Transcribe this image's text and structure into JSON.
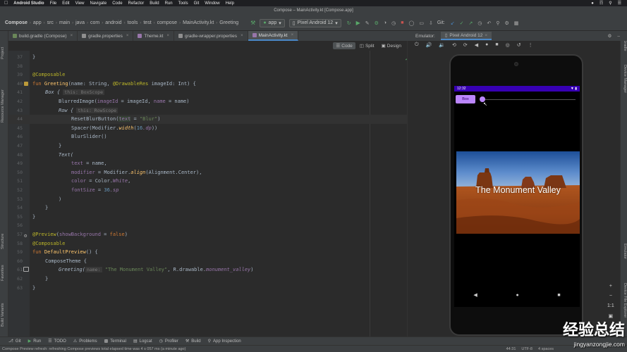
{
  "mac_menu": {
    "app": "Android Studio",
    "items": [
      "File",
      "Edit",
      "View",
      "Navigate",
      "Code",
      "Refactor",
      "Build",
      "Run",
      "Tools",
      "Git",
      "Window",
      "Help"
    ]
  },
  "window_title": "Compose – MainActivity.kt [Compose.app]",
  "breadcrumb": [
    "Compose",
    "app",
    "src",
    "main",
    "java",
    "com",
    "android",
    "tools",
    "test",
    "compose",
    "MainActivity.kt",
    "Greeting"
  ],
  "run_config": "app",
  "device_combo": "Pixel Android 12",
  "git_label": "Git:",
  "tabs": [
    {
      "label": "build.gradle (Compose)",
      "color": "#6a8759",
      "active": false
    },
    {
      "label": "gradle.properties",
      "color": "#a9b7c6",
      "active": false
    },
    {
      "label": "Theme.kt",
      "color": "#9876aa",
      "active": false
    },
    {
      "label": "gradle-wrapper.properties",
      "color": "#a9b7c6",
      "active": false
    },
    {
      "label": "MainActivity.kt",
      "color": "#9876aa",
      "active": true
    }
  ],
  "emulator": {
    "label": "Emulator:",
    "device_tab": "Pixel Android 12",
    "status_time": "12:32",
    "box_button": "Box",
    "image_caption": "The Monument Valley",
    "slider_value": 0
  },
  "editor_modes": {
    "code": "Code",
    "split": "Split",
    "design": "Design"
  },
  "code_lines": [
    {
      "n": "37"
    },
    {
      "n": "38"
    },
    {
      "n": "39"
    },
    {
      "n": "40"
    },
    {
      "n": "41"
    },
    {
      "n": "42"
    },
    {
      "n": "43"
    },
    {
      "n": "44"
    },
    {
      "n": "45"
    },
    {
      "n": "46"
    },
    {
      "n": "47"
    },
    {
      "n": "48"
    },
    {
      "n": "49"
    },
    {
      "n": "50"
    },
    {
      "n": "51"
    },
    {
      "n": "52"
    },
    {
      "n": "53"
    },
    {
      "n": "54"
    },
    {
      "n": "55"
    },
    {
      "n": "56"
    },
    {
      "n": "57"
    },
    {
      "n": "58"
    },
    {
      "n": "59"
    },
    {
      "n": "60"
    },
    {
      "n": "61"
    },
    {
      "n": "62"
    },
    {
      "n": "63"
    }
  ],
  "code": {
    "l37": "}",
    "l39": "@Composable",
    "l40a": "fun ",
    "l40b": "Greeting",
    "l40c": "(name: String, ",
    "l40d": "@DrawableRes",
    "l40e": " imageId: Int) {",
    "l41a": "Box {",
    "l41hint": "this: BoxScope",
    "l42a": "BlurredImage(",
    "l42b": "imageId",
    "l42c": " = imageId, ",
    "l42d": "name",
    "l42e": " = name)",
    "l43a": "Row {",
    "l43hint": "this: RowScope",
    "l44a": "ResetBlurButton(",
    "l44b": "text",
    "l44c": " = ",
    "l44d": "\"Blur\"",
    "l44e": ")",
    "l45a": "Spacer(Modifier.",
    "l45b": "width",
    "l45c": "(",
    "l45d": "16",
    "l45e": ".dp",
    "l45f": "))",
    "l46": "BlurSlider()",
    "l47": "}",
    "l48": "Text(",
    "l49a": "text",
    "l49b": " = name,",
    "l50a": "modifier",
    "l50b": " = Modifier.",
    "l50c": "align",
    "l50d": "(Alignment.Center),",
    "l51a": "color",
    "l51b": " = Color.",
    "l51c": "White",
    "l51d": ",",
    "l52a": "fontSize",
    "l52b": " = ",
    "l52c": "36",
    "l52d": ".sp",
    "l53": ")",
    "l54": "}",
    "l55": "}",
    "l57a": "@Preview",
    "l57b": "(",
    "l57c": "showBackground",
    "l57d": " = ",
    "l57e": "false",
    "l57f": ")",
    "l58": "@Composable",
    "l59a": "fun ",
    "l59b": "DefaultPreview",
    "l59c": "() {",
    "l60": "ComposeTheme {",
    "l61a": "Greeting(",
    "l61hint": "name:",
    "l61b": "\"The Monument Valley\"",
    "l61c": ", R.drawable.",
    "l61d": "monument_valley",
    "l61e": ")",
    "l62": "}",
    "l63": "}"
  },
  "left_strip": [
    "Project",
    "Resource Manager",
    "Structure",
    "Favorites",
    "Build Variants"
  ],
  "right_strip": [
    "Gradle",
    "Device Manager",
    "Emulator",
    "Device File Explorer"
  ],
  "bottom_tools": [
    "Git",
    "Run",
    "TODO",
    "Problems",
    "Terminal",
    "Logcat",
    "Profiler",
    "Build",
    "App Inspection"
  ],
  "status": {
    "message": "Compose Preview refresh: refreshing Compose previews total elapsed time was 4 s 057 ms (a minute ago)",
    "position": "44:31",
    "encoding": "UTF-8",
    "indent": "4 spaces"
  },
  "watermark": {
    "cn": "经验总结",
    "url": "jingyanzongjie.com"
  }
}
